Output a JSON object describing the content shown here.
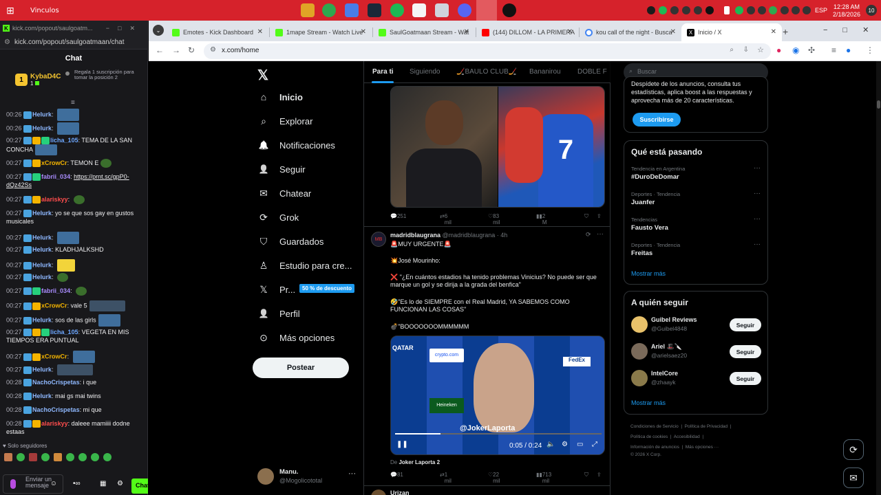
{
  "taskbar": {
    "title": "Vinculos",
    "clock_time": "12:28 AM",
    "clock_date": "2/18/2026",
    "language": "ESP",
    "notification_count": "10"
  },
  "chat_window": {
    "tab_url": "kick.com/popout/saulgoatm...",
    "url": "kick.com/popout/saulgoatmaan/chat",
    "header": "Chat",
    "sub_user": "KybaD4C",
    "sub_count": "1",
    "sub_gift_text": "Regala 1 suscripción para tomar la posición 2",
    "followers_only": "Solo seguidores",
    "input_placeholder": "Enviar un mensaje",
    "send_label": "Chat",
    "messages": [
      {
        "ts": "00:26",
        "user": "Helurk",
        "text": ""
      },
      {
        "ts": "00:26",
        "user": "Helurk",
        "text": ""
      },
      {
        "ts": "00:27",
        "user": "licha_105",
        "text": "TEMA DE LA SAN CONCHA"
      },
      {
        "ts": "00:27",
        "user": "xCrowCr",
        "text": "TEMON E"
      },
      {
        "ts": "00:27",
        "user": "fabrii_034",
        "text": "https://prnt.sc/gpP0-dQz42Ss"
      },
      {
        "ts": "00:27",
        "user": "alariskyy",
        "text": ""
      },
      {
        "ts": "00:27",
        "user": "Helurk",
        "text": "yo se que sos gay en gustos musicales"
      },
      {
        "ts": "00:27",
        "user": "Helurk",
        "text": ""
      },
      {
        "ts": "00:27",
        "user": "Helurk",
        "text": "KLADHJALKSHD"
      },
      {
        "ts": "00:27",
        "user": "Helurk",
        "text": ""
      },
      {
        "ts": "00:27",
        "user": "Helurk",
        "text": ""
      },
      {
        "ts": "00:27",
        "user": "fabrii_034",
        "text": ""
      },
      {
        "ts": "00:27",
        "user": "xCrowCr",
        "text": "vale 5"
      },
      {
        "ts": "00:27",
        "user": "Helurk",
        "text": "sos de las girls"
      },
      {
        "ts": "00:27",
        "user": "licha_105",
        "text": "VEGETA EN MIS TIEMPOS ERA PUNTUAL"
      },
      {
        "ts": "00:27",
        "user": "xCrowCr",
        "text": ""
      },
      {
        "ts": "00:27",
        "user": "Helurk",
        "text": ""
      },
      {
        "ts": "00:28",
        "user": "NachoCrispetas",
        "text": "i que"
      },
      {
        "ts": "00:28",
        "user": "Helurk",
        "text": "mai gs mai twins"
      },
      {
        "ts": "00:28",
        "user": "NachoCrispetas",
        "text": "mi que"
      },
      {
        "ts": "00:28",
        "user": "alariskyy",
        "text": "daleee mamiiii dodne estaas"
      }
    ]
  },
  "browser": {
    "tabs": [
      {
        "label": "Emotes - Kick Dashboard"
      },
      {
        "label": "1mape Stream - Watch Live"
      },
      {
        "label": "SaulGoatmaan Stream - Wat"
      },
      {
        "label": "(144) DILLOM - LA PRIMERA"
      },
      {
        "label": "kou call of the night - Busca"
      },
      {
        "label": "Inicio / X"
      }
    ],
    "url": "x.com/home"
  },
  "x": {
    "nav": [
      {
        "label": "Inicio",
        "icon": "home-icon"
      },
      {
        "label": "Explorar",
        "icon": "search-icon"
      },
      {
        "label": "Notificaciones",
        "icon": "bell-icon"
      },
      {
        "label": "Seguir",
        "icon": "add-person-icon"
      },
      {
        "label": "Chatear",
        "icon": "mail-icon"
      },
      {
        "label": "Grok",
        "icon": "grok-icon"
      },
      {
        "label": "Guardados",
        "icon": "bookmark-icon"
      },
      {
        "label": "Estudio para cre...",
        "icon": "studio-icon"
      },
      {
        "label": "Pr...",
        "icon": "x-logo-icon"
      },
      {
        "label": "Perfil",
        "icon": "person-icon"
      },
      {
        "label": "Más opciones",
        "icon": "more-circle-icon"
      }
    ],
    "premium_badge": "50 % de descuento",
    "post_button": "Postear",
    "profile": {
      "name": "Manu.",
      "handle": "@Mogolicototal"
    },
    "feed_tabs": [
      "Para ti",
      "Siguiendo",
      "🏒BAULO CLUB🏒",
      "Bananirou",
      "DOBLE F"
    ],
    "tweet1_actions": {
      "replies": "251",
      "reposts": "6 mil",
      "likes": "83 mil",
      "views": "2 M"
    },
    "tweet2": {
      "name": "madridblaugrana",
      "handle": "@madridblaugrana",
      "time": "· 4h",
      "line1": "🚨MUY URGENTE🚨",
      "line2": "💥José Mourinho:",
      "line3": "❌ \"¿En cuántos estadios ha tenido problemas Vinicius? No puede ser que marque un gol y se dirija a la grada del benfica\"",
      "line4": "🤣\"Es lo de SIEMPRE con el Real Madrid, YA SABEMOS COMO FUNCIONAN LAS COSAS\"",
      "line5": "💣\"BOOOOOOOMMMMMM",
      "video_time": "0:05 / 0:24",
      "video_overlay": "@JokerLaporta",
      "source": "De",
      "source_name": "Joker Laporta 2",
      "actions": {
        "replies": "81",
        "reposts": "1 mil",
        "likes": "22 mil",
        "views": "713 mil"
      }
    },
    "tweet3_name": "Urizan",
    "search_placeholder": "Buscar",
    "premium_box": {
      "text": "Despídete de los anuncios, consulta tus estadísticas, aplica boost a las respuestas y aprovecha más de 20 características.",
      "button": "Suscribirse"
    },
    "trends_title": "Qué está pasando",
    "trends": [
      {
        "cat": "Tendencia en Argentina",
        "name": "#DuroDeDomar"
      },
      {
        "cat": "Deportes · Tendencia",
        "name": "Juanfer"
      },
      {
        "cat": "Tendencias",
        "name": "Fausto Vera"
      },
      {
        "cat": "Deportes · Tendencia",
        "name": "Freitas"
      }
    ],
    "show_more": "Mostrar más",
    "who_title": "A quién seguir",
    "who": [
      {
        "name": "Guibel Reviews",
        "handle": "@Guibel4848"
      },
      {
        "name": "Ariel 🎩🔪",
        "handle": "@arielsaez20"
      },
      {
        "name": "IntelCore",
        "handle": "@zhaayk"
      }
    ],
    "follow_label": "Seguir",
    "footer": {
      "l1": "Condiciones de Servicio",
      "l2": "Política de Privacidad",
      "l3": "Política de cookies",
      "l4": "Accesibilidad",
      "l5": "Información de anuncios",
      "l6": "Más opciones ···",
      "copyright": "© 2026 X Corp."
    }
  },
  "colors": {
    "accent": "#1d9bf0",
    "kick": "#53fc18",
    "taskbar": "#d6222b"
  }
}
